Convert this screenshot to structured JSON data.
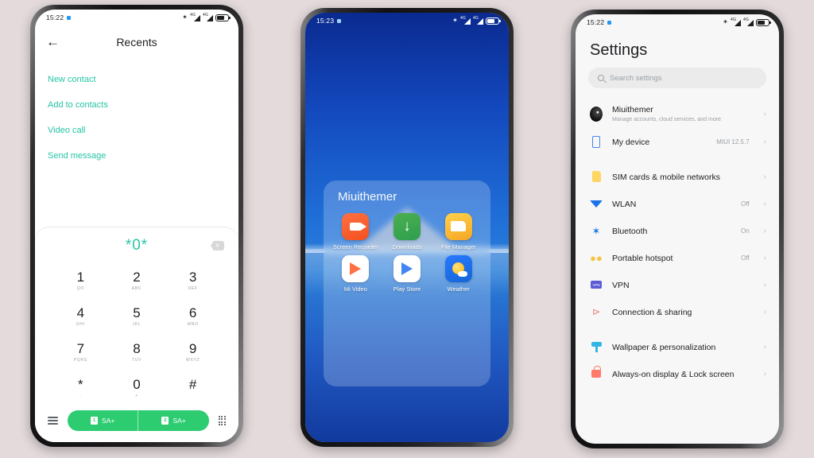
{
  "background_color": "#e4dadb",
  "phone1": {
    "name": "dialer-phone",
    "status_bar": {
      "time": "15:22",
      "battery_icon": "battery-icon",
      "bluetooth_icon": "bluetooth-icon",
      "signal_icon": "signal-bars-icon",
      "network": "4G"
    },
    "header": {
      "back_icon": "back-arrow-icon",
      "title": "Recents"
    },
    "suggestions": [
      "New contact",
      "Add to contacts",
      "Video call",
      "Send message"
    ],
    "dialpad": {
      "dialed_number": "*0*",
      "backspace_icon": "backspace-icon",
      "accent_color": "#25c5a5",
      "keys": [
        {
          "digit": "1",
          "letters": "QO"
        },
        {
          "digit": "2",
          "letters": "ABC"
        },
        {
          "digit": "3",
          "letters": "DEF"
        },
        {
          "digit": "4",
          "letters": "GHI"
        },
        {
          "digit": "5",
          "letters": "JKL"
        },
        {
          "digit": "6",
          "letters": "MNO"
        },
        {
          "digit": "7",
          "letters": "PQRS"
        },
        {
          "digit": "8",
          "letters": "TUV"
        },
        {
          "digit": "9",
          "letters": "WXYZ"
        },
        {
          "digit": "*",
          "letters": ","
        },
        {
          "digit": "0",
          "letters": "+"
        },
        {
          "digit": "#",
          "letters": ""
        }
      ],
      "bottom_bar": {
        "menu_icon": "hamburger-menu-icon",
        "call_button_color": "#2ecc71",
        "call_sim1_label": "SA+",
        "call_sim2_label": "SA+",
        "sim1_badge": "1",
        "sim2_badge": "2",
        "keypad_icon": "keypad-grid-icon"
      }
    }
  },
  "phone2": {
    "name": "home-screen-phone",
    "status_bar": {
      "time": "15:23",
      "battery_icon": "battery-icon",
      "bluetooth_icon": "bluetooth-icon",
      "signal_icon": "signal-bars-icon",
      "network": "4G"
    },
    "folder": {
      "title": "Miuithemer",
      "apps": [
        {
          "label": "Screen Recorder",
          "icon": "screen-recorder-icon"
        },
        {
          "label": "Downloads",
          "icon": "downloads-icon"
        },
        {
          "label": "File Manager",
          "icon": "file-manager-icon"
        },
        {
          "label": "Mi Video",
          "icon": "mi-video-icon"
        },
        {
          "label": "Play Store",
          "icon": "play-store-icon"
        },
        {
          "label": "Weather",
          "icon": "weather-icon"
        }
      ]
    }
  },
  "phone3": {
    "name": "settings-phone",
    "status_bar": {
      "time": "15:22",
      "battery_icon": "battery-icon",
      "bluetooth_icon": "bluetooth-icon",
      "signal_icon": "signal-bars-icon",
      "network": "4G"
    },
    "title": "Settings",
    "search": {
      "placeholder": "Search settings",
      "icon": "search-icon"
    },
    "groups": [
      {
        "rows": [
          {
            "label": "Miuithemer",
            "sub": "Manage accounts, cloud services, and more",
            "value": "",
            "icon": "account-avatar"
          },
          {
            "label": "My device",
            "sub": "",
            "value": "MIUI 12.5.7",
            "icon": "phone-icon"
          }
        ]
      },
      {
        "rows": [
          {
            "label": "SIM cards & mobile networks",
            "sub": "",
            "value": "",
            "icon": "sim-card-icon"
          },
          {
            "label": "WLAN",
            "sub": "",
            "value": "Off",
            "icon": "wifi-icon"
          },
          {
            "label": "Bluetooth",
            "sub": "",
            "value": "On",
            "icon": "bluetooth-icon"
          },
          {
            "label": "Portable hotspot",
            "sub": "",
            "value": "Off",
            "icon": "hotspot-icon"
          },
          {
            "label": "VPN",
            "sub": "",
            "value": "",
            "icon": "vpn-icon"
          },
          {
            "label": "Connection & sharing",
            "sub": "",
            "value": "",
            "icon": "share-icon"
          }
        ]
      },
      {
        "rows": [
          {
            "label": "Wallpaper & personalization",
            "sub": "",
            "value": "",
            "icon": "wallpaper-icon"
          },
          {
            "label": "Always-on display & Lock screen",
            "sub": "",
            "value": "",
            "icon": "lock-icon"
          }
        ]
      }
    ]
  }
}
